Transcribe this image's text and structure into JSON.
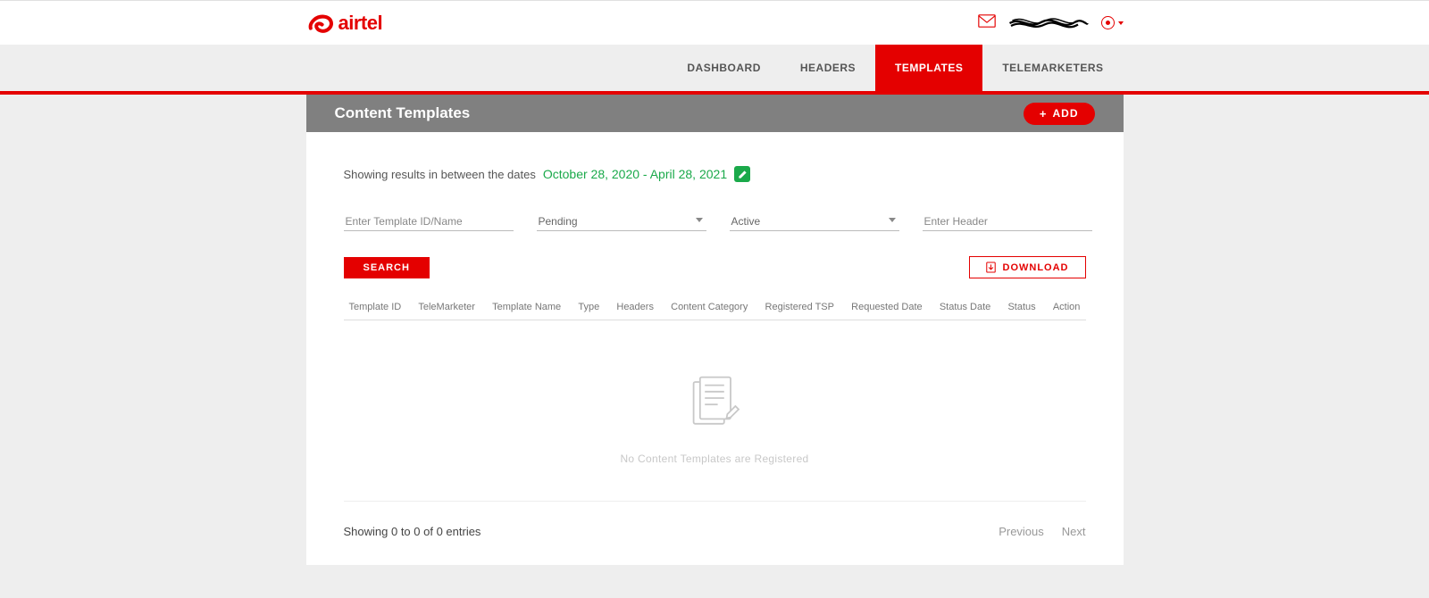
{
  "brand": {
    "name": "airtel"
  },
  "nav": {
    "items": [
      {
        "label": "DASHBOARD",
        "active": false
      },
      {
        "label": "HEADERS",
        "active": false
      },
      {
        "label": "TEMPLATES",
        "active": true
      },
      {
        "label": "TELEMARKETERS",
        "active": false
      }
    ]
  },
  "panel": {
    "title": "Content Templates",
    "add_label": "ADD",
    "date_prefix": "Showing results in between the dates",
    "date_range": "October 28, 2020 - April 28, 2021"
  },
  "filters": {
    "template_placeholder": "Enter Template ID/Name",
    "status_select": "Pending",
    "state_select": "Active",
    "header_placeholder": "Enter Header"
  },
  "buttons": {
    "search": "SEARCH",
    "download": "DOWNLOAD"
  },
  "table": {
    "columns": [
      "Template ID",
      "TeleMarketer",
      "Template Name",
      "Type",
      "Headers",
      "Content Category",
      "Registered TSP",
      "Requested Date",
      "Status Date",
      "Status",
      "Action"
    ],
    "empty_text": "No Content Templates are Registered"
  },
  "footer": {
    "showing": "Showing 0 to 0 of 0 entries",
    "prev": "Previous",
    "next": "Next"
  }
}
